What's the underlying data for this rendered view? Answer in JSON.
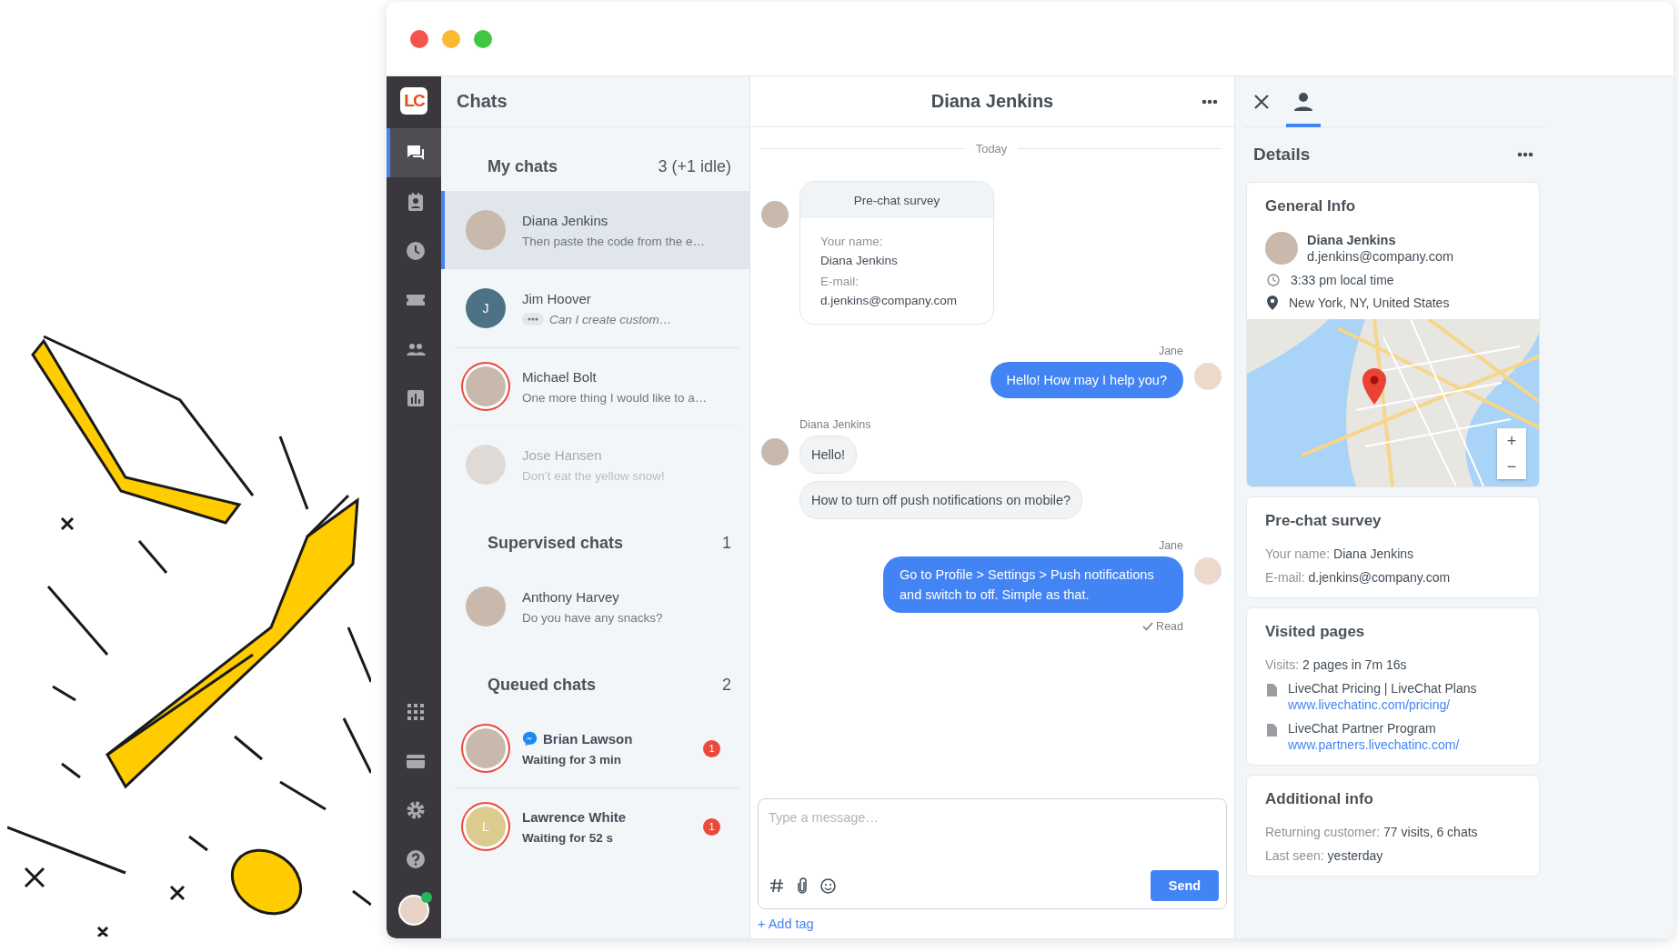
{
  "nav": {
    "logo": "LC",
    "top_items": [
      {
        "kind": "chats",
        "selected": true
      },
      {
        "kind": "contacts",
        "selected": false
      },
      {
        "kind": "history",
        "selected": false
      },
      {
        "kind": "tickets",
        "selected": false
      },
      {
        "kind": "agents",
        "selected": false
      },
      {
        "kind": "reports",
        "selected": false
      }
    ],
    "bottom_items": [
      {
        "kind": "apps",
        "selected": false
      },
      {
        "kind": "billing",
        "selected": false
      },
      {
        "kind": "settings",
        "selected": false
      },
      {
        "kind": "help",
        "selected": false
      }
    ],
    "user": {
      "online": true
    }
  },
  "chat_list": {
    "title": "Chats",
    "sections": [
      {
        "title": "My chats",
        "count": "3 (+1 idle)",
        "chats": [
          {
            "name": "Diana Jenkins",
            "preview": "Then paste the code from the e…",
            "selected": true,
            "kind": "active",
            "urgent": false,
            "idle": false,
            "typing": false
          },
          {
            "name": "Jim Hoover",
            "preview": "Can I create custom…",
            "selected": false,
            "kind": "active",
            "initial": "J",
            "color": "#4e7285",
            "urgent": false,
            "idle": false,
            "typing": true
          },
          {
            "name": "Michael Bolt",
            "preview": "One more thing I would like to a…",
            "selected": false,
            "kind": "active",
            "urgent": true,
            "idle": false,
            "typing": false
          },
          {
            "name": "Jose Hansen",
            "preview": "Don’t eat the yellow snow!",
            "selected": false,
            "kind": "active",
            "urgent": false,
            "idle": true,
            "typing": false
          }
        ]
      },
      {
        "title": "Supervised chats",
        "count": "1",
        "chats": [
          {
            "name": "Anthony Harvey",
            "preview": "Do you have any snacks?",
            "selected": false,
            "kind": "active",
            "urgent": false,
            "idle": false,
            "typing": false
          }
        ]
      },
      {
        "title": "Queued chats",
        "count": "2",
        "chats": [
          {
            "name": "Brian Lawson",
            "preview": "Waiting for 3 min",
            "selected": false,
            "kind": "queued",
            "urgent": true,
            "idle": false,
            "typing": false,
            "messenger": true,
            "unread": "1"
          },
          {
            "name": "Lawrence White",
            "preview": "Waiting for 52 s",
            "selected": false,
            "kind": "queued",
            "initial": "L",
            "color": "#dccb8e",
            "urgent": true,
            "idle": false,
            "typing": false,
            "unread": "1"
          }
        ]
      }
    ]
  },
  "chat": {
    "title": "Diana Jenkins",
    "date": "Today",
    "messages": [
      {
        "kind": "survey",
        "title": "Pre-chat survey",
        "fields": [
          {
            "label": "Your name:",
            "value": "Diana Jenkins"
          },
          {
            "label": "E-mail:",
            "value": "d.jenkins@company.com"
          }
        ]
      },
      {
        "kind": "agent",
        "author": "Jane",
        "texts": [
          "Hello! How may I help you?"
        ]
      },
      {
        "kind": "visitor",
        "author": "Diana Jenkins",
        "texts": [
          "Hello!",
          "How to turn off push notifications on mobile?"
        ]
      },
      {
        "kind": "agent",
        "author": "Jane",
        "texts": [
          "Go to Profile > Settings > Push notifications and switch to off. Simple as that."
        ],
        "receipt": "Read"
      }
    ],
    "composer": {
      "placeholder": "Type a message…",
      "send": "Send",
      "add_tag": "+ Add tag"
    }
  },
  "details": {
    "tab_selected": true,
    "title": "Details",
    "general": {
      "title": "General Info",
      "name": "Diana Jenkins",
      "email": "d.jenkins@company.com",
      "local_time": "3:33 pm local time",
      "location": "New York, NY, United States",
      "map": {
        "zoom_in": "+",
        "zoom_out": "−"
      }
    },
    "survey": {
      "title": "Pre-chat survey",
      "fields": [
        {
          "label": "Your name:",
          "value": "Diana Jenkins"
        },
        {
          "label": "E-mail:",
          "value": "d.jenkins@company.com"
        }
      ]
    },
    "visited": {
      "title": "Visited pages",
      "visits_label": "Visits:",
      "visits_value": "2 pages in 7m 16s",
      "pages": [
        {
          "title": "LiveChat Pricing | LiveChat Plans",
          "url": "www.livechatinc.com/pricing/"
        },
        {
          "title": "LiveChat Partner Program",
          "url": "www.partners.livechatinc.com/"
        }
      ]
    },
    "additional": {
      "title": "Additional info",
      "fields": [
        {
          "label": "Returning customer:",
          "value": "77 visits, 6 chats"
        },
        {
          "label": "Last seen:",
          "value": "yesterday"
        }
      ]
    }
  }
}
